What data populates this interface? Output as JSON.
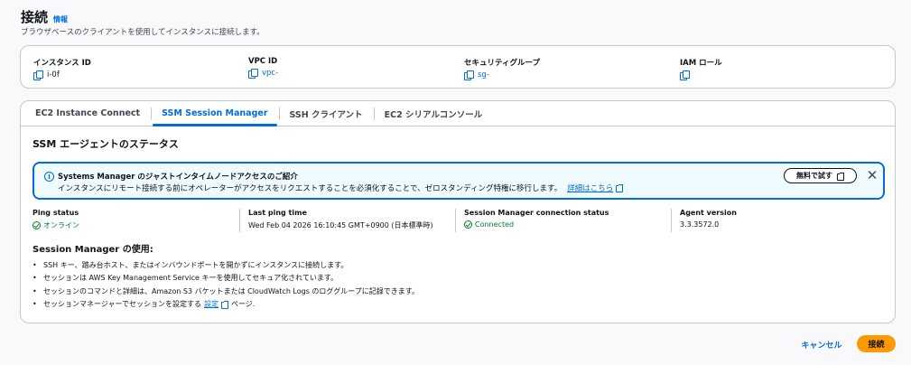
{
  "header": {
    "title": "接続",
    "info_link": "情報",
    "subtitle": "ブラウザベースのクライアントを使用してインスタンスに接続します。"
  },
  "details": [
    {
      "label": "インスタンス ID",
      "value": "i-0f",
      "is_link": false
    },
    {
      "label": "VPC ID",
      "value": "vpc-",
      "is_link": true
    },
    {
      "label": "セキュリティグループ",
      "value": "sg-",
      "is_link": true
    },
    {
      "label": "IAM ロール",
      "value": "",
      "is_link": false
    }
  ],
  "tabs": [
    {
      "label": "EC2 Instance Connect",
      "active": false
    },
    {
      "label": "SSM Session Manager",
      "active": true
    },
    {
      "label": "SSH クライアント",
      "active": false
    },
    {
      "label": "EC2 シリアルコンソール",
      "active": false
    }
  ],
  "panel": {
    "heading": "SSM エージェントのステータス"
  },
  "flash": {
    "icon": "info-icon",
    "title": "Systems Manager のジャストインタイムノードアクセスのご紹介",
    "body": "インスタンスにリモート接続する前にオペレーターがアクセスをリクエストすることを必須化することで、ゼロスタンディング特権に移行します。",
    "link": "詳細はこちら",
    "try_button": "無料で試す",
    "close": "✕"
  },
  "status": {
    "ping_status": {
      "label": "Ping status",
      "value": "オンライン"
    },
    "last_ping": {
      "label": "Last ping time",
      "value": "Wed Feb 04 2026 16:10:45 GMT+0900 (日本標準時)"
    },
    "connection": {
      "label": "Session Manager connection status",
      "value": "Connected"
    },
    "agent": {
      "label": "Agent version",
      "value": "3.3.3572.0"
    }
  },
  "usage": {
    "heading": "Session Manager の使用:",
    "items": [
      "SSH キー、踏み台ホスト、またはインバウンドポートを開かずにインスタンスに接続します。",
      "セッションは AWS Key Management Service キーを使用してセキュア化されています。",
      "セッションのコマンドと詳細は、Amazon S3 バケットまたは CloudWatch Logs のロググループに記録できます。"
    ],
    "last_item_prefix": "セッションマネージャーでセッションを設定する",
    "last_item_link": "設定",
    "last_item_suffix": "ページ."
  },
  "footer": {
    "cancel": "キャンセル",
    "connect": "接続"
  },
  "colors": {
    "link": "#006ce0",
    "success": "#00802f",
    "primary_button": "#ff9900",
    "info_bg": "#f0fbff"
  }
}
